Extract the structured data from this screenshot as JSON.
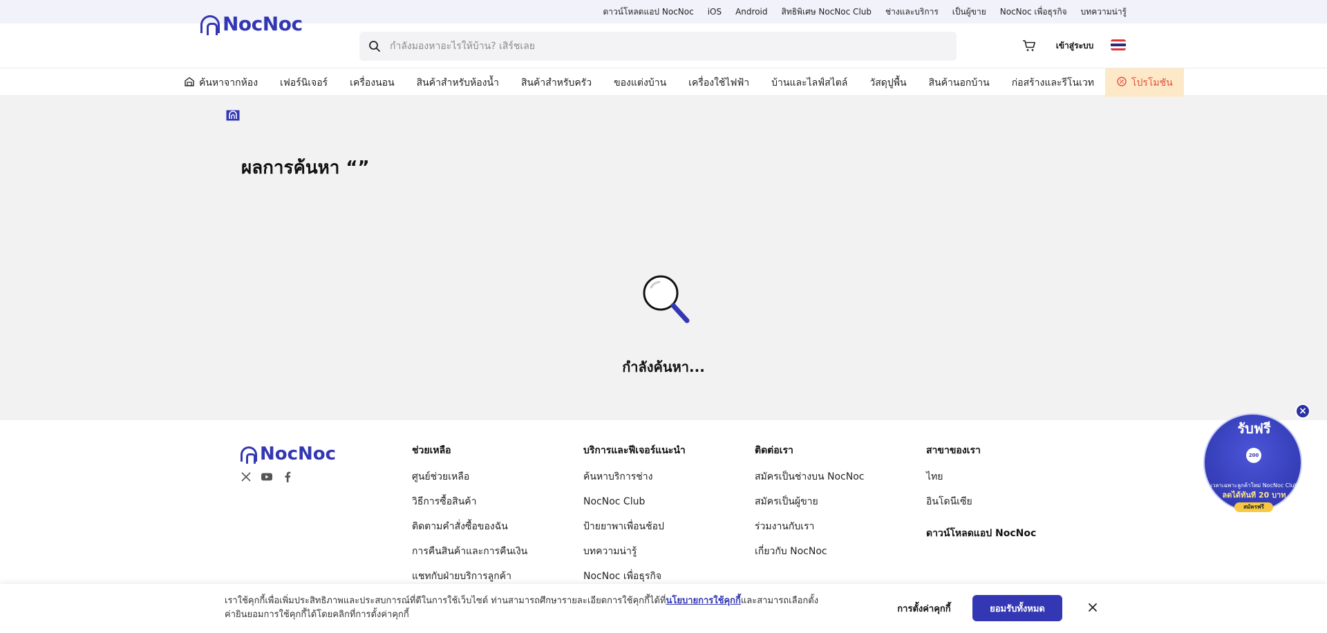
{
  "topbar": {
    "items": [
      "ดาวน์โหลดแอป NocNoc",
      "iOS",
      "Android",
      "สิทธิพิเศษ NocNoc Club",
      "ช่างและบริการ",
      "เป็นผู้ขาย",
      "NocNoc เพื่อธุรกิจ",
      "บทความน่ารู้"
    ]
  },
  "header": {
    "logo_text": "NocNoc",
    "search_placeholder": "กำลังมองหาอะไรให้บ้าน? เสิร์ชเลย",
    "login_label": "เข้าสู่ระบบ"
  },
  "nav": {
    "items": [
      "ค้นหาจากห้อง",
      "เฟอร์นิเจอร์",
      "เครื่องนอน",
      "สินค้าสำหรับห้องน้ำ",
      "สินค้าสำหรับครัว",
      "ของแต่งบ้าน",
      "เครื่องใช้ไฟฟ้า",
      "บ้านและไลฟ์สไตล์",
      "วัสดุปูพื้น",
      "สินค้านอกบ้าน",
      "ก่อสร้างและรีโนเวท",
      "โปรโมชัน"
    ]
  },
  "main": {
    "result_title": "ผลการค้นหา “”",
    "searching_text": "กำลังค้นหา..."
  },
  "footer": {
    "logo_text": "NocNoc",
    "columns": [
      {
        "title": "ช่วยเหลือ",
        "links": [
          "ศูนย์ช่วยเหลือ",
          "วิธีการซื้อสินค้า",
          "ติดตามคำสั่งซื้อของฉัน",
          "การคืนสินค้าและการคืนเงิน",
          "แชทกับฝ่ายบริการลูกค้า"
        ]
      },
      {
        "title": "บริการและฟีเจอร์แนะนำ",
        "links": [
          "ค้นหาบริการช่าง",
          "NocNoc Club",
          "ป้ายยาพาเพื่อนช้อป",
          "บทความน่ารู้",
          "NocNoc เพื่อธุรกิจ"
        ]
      },
      {
        "title": "ติดต่อเรา",
        "links": [
          "สมัครเป็นช่างบน NocNoc",
          "สมัครเป็นผู้ขาย",
          "ร่วมงานกับเรา",
          "เกี่ยวกับ NocNoc"
        ]
      },
      {
        "title": "สาขาของเรา",
        "links": [
          "ไทย",
          "อินโดนีเซีย"
        ],
        "second_title": "ดาวน์โหลดแอป NocNoc"
      }
    ]
  },
  "promo": {
    "headline": "รับฟรี",
    "coin": "200",
    "line1": "เวลาเฉพาะลูกค้าใหม่ NocNoc Club",
    "line2": "ลดได้ทันที 20 บาท",
    "button": "สมัครฟรี"
  },
  "cookie": {
    "text_before": "เราใช้คุกกี้เพื่อเพิ่มประสิทธิภาพและประสบการณ์ที่ดีในการใช้เว็บไซต์ ท่านสามารถศึกษารายละเอียดการใช้คุกกี้ได้ที่",
    "policy_link": "นโยบายการใช้คุกกี้",
    "text_after": "และสามารถเลือกตั้งค่ายินยอมการใช้คุกกี้ได้โดยคลิกที่การตั้งค่าคุกกี้",
    "settings_label": "การตั้งค่าคุกกี้",
    "accept_label": "ยอมรับทั้งหมด"
  },
  "colors": {
    "brand": "#3337b3",
    "promo_bg": "#fde9c8",
    "promo_text": "#e0503c"
  },
  "icons": {
    "search": "search-icon",
    "cart": "cart-icon",
    "flag": "thai-flag-icon",
    "room": "room-icon",
    "promo": "promo-icon",
    "home": "home-icon",
    "magnifier": "magnifier-illustration",
    "close": "close-icon"
  }
}
